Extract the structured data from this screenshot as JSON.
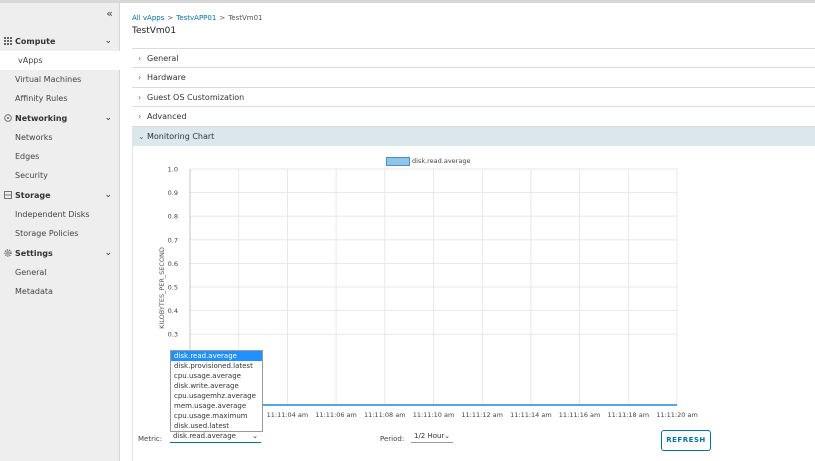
{
  "sidebar": {
    "collapse_glyph": "«",
    "groups": [
      {
        "label": "Compute",
        "icon": "grid-icon",
        "items": [
          "vApps",
          "Virtual Machines",
          "Affinity Rules"
        ]
      },
      {
        "label": "Networking",
        "icon": "network-icon",
        "items": [
          "Networks",
          "Edges",
          "Security"
        ]
      },
      {
        "label": "Storage",
        "icon": "storage-icon",
        "items": [
          "Independent Disks",
          "Storage Policies"
        ]
      },
      {
        "label": "Settings",
        "icon": "gear-icon",
        "items": [
          "General",
          "Metadata"
        ]
      }
    ],
    "active_item": "vApps"
  },
  "breadcrumb": {
    "items": [
      "All vApps",
      "TestvAPP01",
      "TestVm01"
    ]
  },
  "page_title": "TestVm01",
  "sections": [
    "General",
    "Hardware",
    "Guest OS Customization",
    "Advanced",
    "Monitoring Chart"
  ],
  "chart_data": {
    "type": "line",
    "series": [
      {
        "name": "disk.read.average",
        "values": []
      }
    ],
    "ylabel": "KILOBYTES_PER_SECOND",
    "ylim": [
      0,
      1.0
    ],
    "y_ticks": [
      "1.0",
      "0.9",
      "0.8",
      "0.7",
      "0.6",
      "0.5",
      "0.4",
      "0.3"
    ],
    "x_ticks": [
      "11:11:04 am",
      "11:11:06 am",
      "11:11:08 am",
      "11:11:10 am",
      "11:11:12 am",
      "11:11:14 am",
      "11:11:16 am",
      "11:11:18 am",
      "11:11:20 am"
    ],
    "grid": true,
    "legend": "top-center",
    "series_color": "#8ec5e8"
  },
  "metric": {
    "label": "Metric:",
    "value": "disk.read.average",
    "options": [
      "disk.read.average",
      "disk.provisioned.latest",
      "cpu.usage.average",
      "disk.write.average",
      "cpu.usagemhz.average",
      "mem.usage.average",
      "cpu.usage.maximum",
      "disk.used.latest"
    ]
  },
  "period": {
    "label": "Period:",
    "value": "1/2 Hour"
  },
  "refresh_label": "REFRESH",
  "colors": {
    "accent": "#0072a3",
    "selected_option": "#1e90ff",
    "open_section": "#dce7ed"
  }
}
